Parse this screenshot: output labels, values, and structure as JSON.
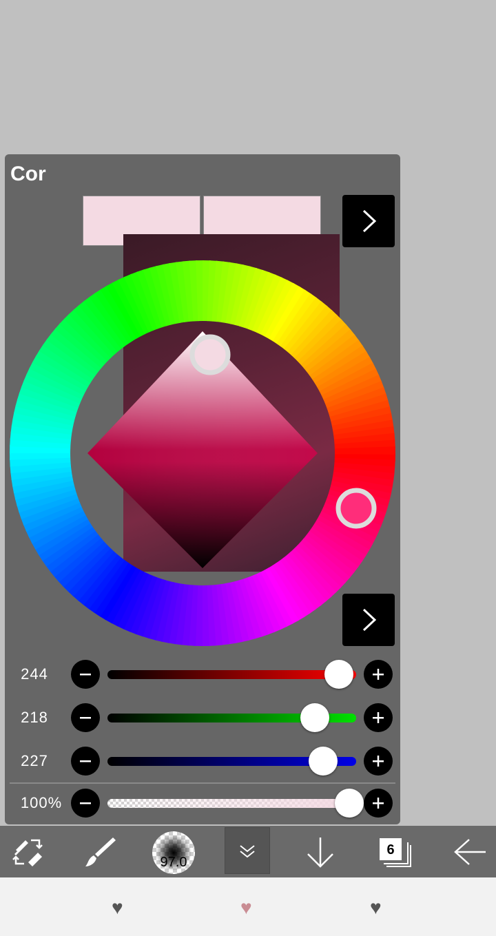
{
  "panel": {
    "title": "Cor"
  },
  "colors": {
    "current": "#f4dae3",
    "previous": "#f4dae3",
    "hue": "#ff2d7a",
    "panel_bg": "#666666"
  },
  "sliders": [
    {
      "label": "244",
      "value": 244,
      "max": 255,
      "channel": "red"
    },
    {
      "label": "218",
      "value": 218,
      "max": 255,
      "channel": "green"
    },
    {
      "label": "227",
      "value": 227,
      "max": 255,
      "channel": "blue"
    },
    {
      "label": "100%",
      "value": 100,
      "max": 100,
      "channel": "alpha"
    }
  ],
  "toolbar": {
    "brush_size": "97.0",
    "layer_count": "6",
    "icons": [
      "swap-tool-icon",
      "brush-icon",
      "brush-size-icon",
      "chevron-double-down-icon",
      "arrow-down-icon",
      "layers-icon",
      "arrow-left-icon"
    ]
  },
  "bottom_nav": {
    "icons": [
      "heart-icon",
      "heart-icon",
      "heart-icon"
    ],
    "colors": [
      "#555555",
      "#c98c93",
      "#555555"
    ]
  }
}
